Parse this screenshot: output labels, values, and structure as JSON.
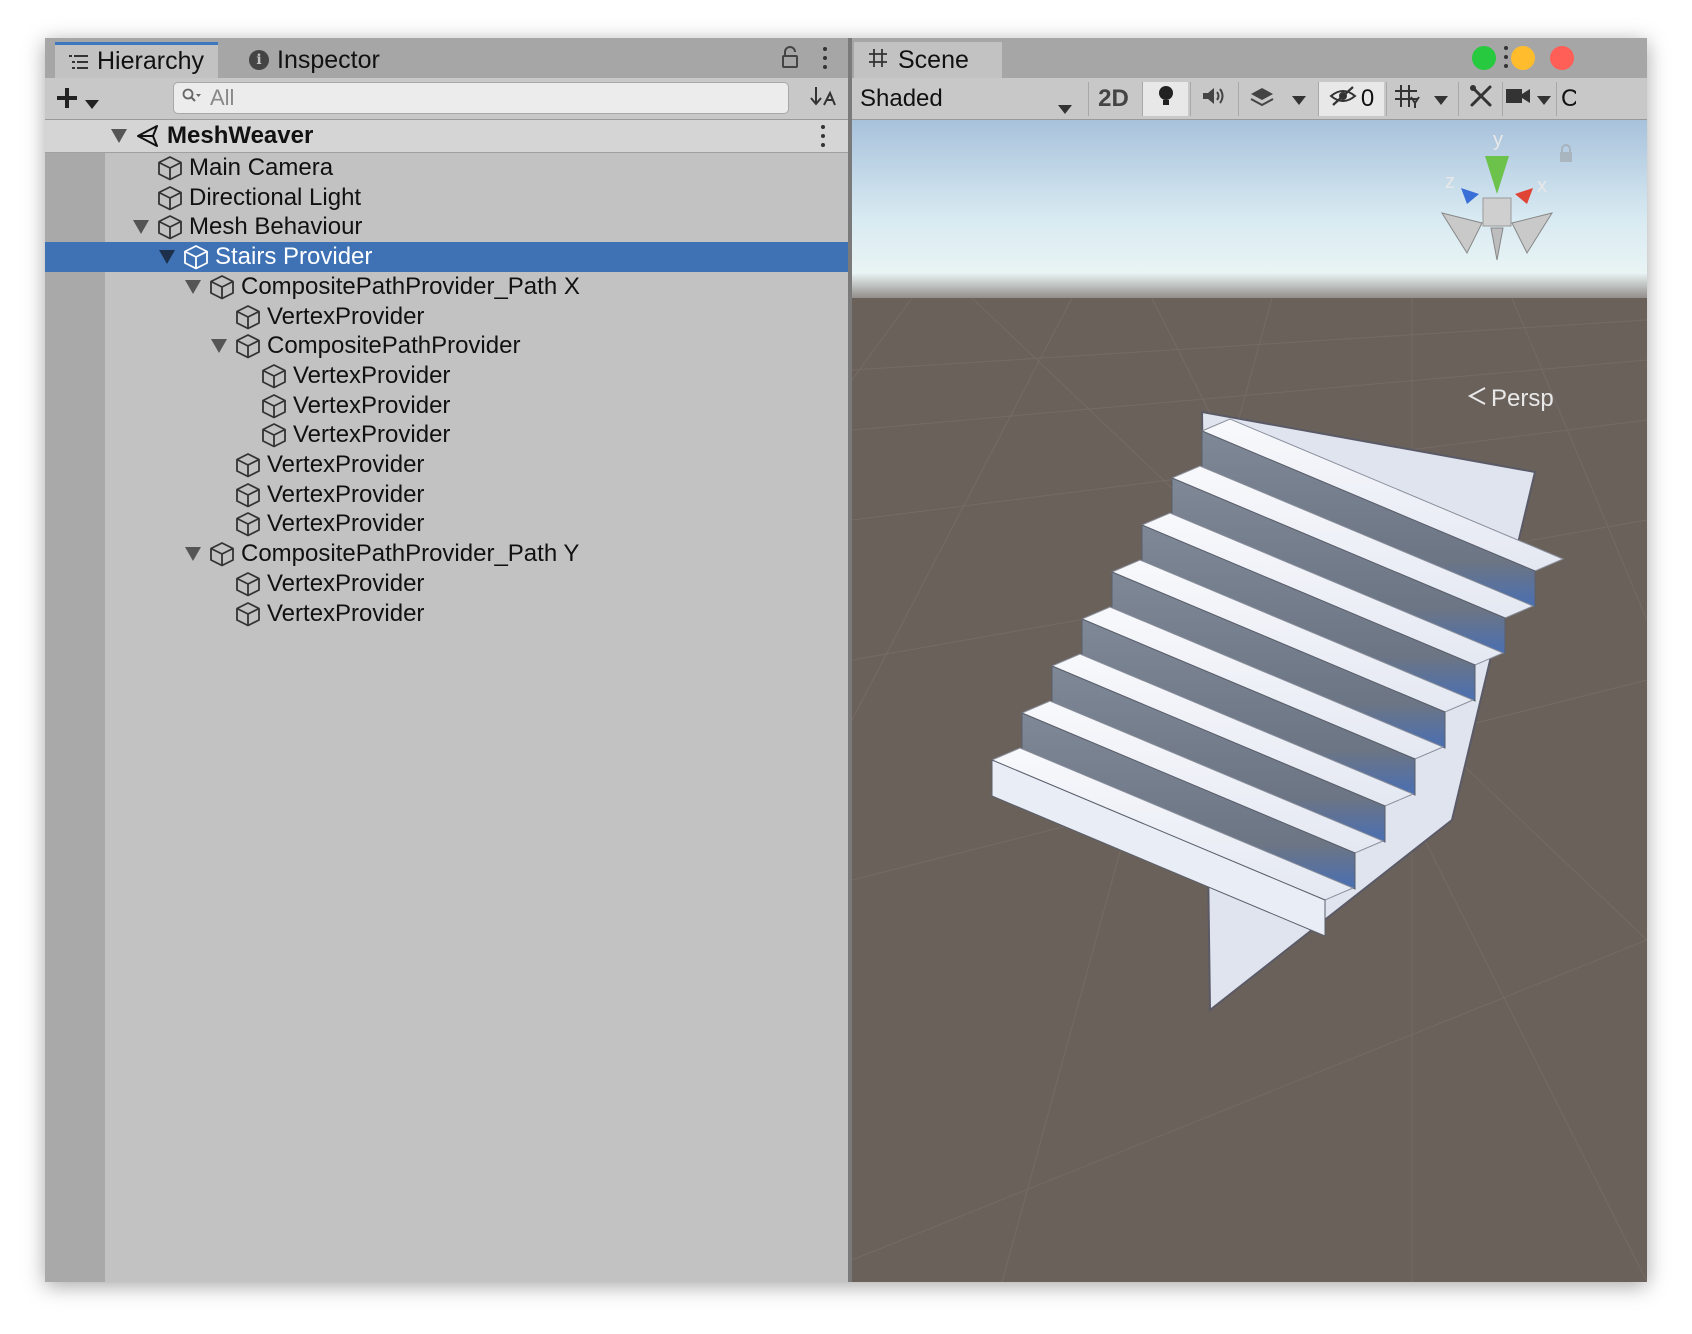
{
  "hierarchy_panel": {
    "tabs": [
      {
        "label": "Hierarchy",
        "icon": "list-icon",
        "active": true
      },
      {
        "label": "Inspector",
        "icon": "info-icon",
        "active": false
      }
    ],
    "search": {
      "placeholder": "All",
      "value": ""
    },
    "scene": {
      "name": "MeshWeaver"
    },
    "tree": [
      {
        "label": "Main Camera",
        "depth": 1,
        "expanded": null,
        "selected": false
      },
      {
        "label": "Directional Light",
        "depth": 1,
        "expanded": null,
        "selected": false
      },
      {
        "label": "Mesh Behaviour",
        "depth": 1,
        "expanded": true,
        "selected": false
      },
      {
        "label": "Stairs Provider",
        "depth": 2,
        "expanded": true,
        "selected": true
      },
      {
        "label": "CompositePathProvider_Path X",
        "depth": 3,
        "expanded": true,
        "selected": false
      },
      {
        "label": "VertexProvider",
        "depth": 4,
        "expanded": null,
        "selected": false
      },
      {
        "label": "CompositePathProvider",
        "depth": 4,
        "expanded": true,
        "selected": false
      },
      {
        "label": "VertexProvider",
        "depth": 5,
        "expanded": null,
        "selected": false
      },
      {
        "label": "VertexProvider",
        "depth": 5,
        "expanded": null,
        "selected": false
      },
      {
        "label": "VertexProvider",
        "depth": 5,
        "expanded": null,
        "selected": false
      },
      {
        "label": "VertexProvider",
        "depth": 4,
        "expanded": null,
        "selected": false
      },
      {
        "label": "VertexProvider",
        "depth": 4,
        "expanded": null,
        "selected": false
      },
      {
        "label": "VertexProvider",
        "depth": 4,
        "expanded": null,
        "selected": false
      },
      {
        "label": "CompositePathProvider_Path Y",
        "depth": 3,
        "expanded": true,
        "selected": false
      },
      {
        "label": "VertexProvider",
        "depth": 4,
        "expanded": null,
        "selected": false
      },
      {
        "label": "VertexProvider",
        "depth": 4,
        "expanded": null,
        "selected": false
      }
    ]
  },
  "scene_panel": {
    "tab": {
      "label": "Scene",
      "icon": "grid-icon"
    },
    "toolbar": {
      "shading_mode": "Shaded",
      "mode_2d": "2D",
      "hidden_count": "0",
      "cut_off": "C"
    },
    "gizmo": {
      "y": "y",
      "x": "x",
      "z": "z"
    },
    "projection": "Persp",
    "window_controls": {
      "green": "#27c93f",
      "yellow": "#ffbd2e",
      "red": "#ff5f56"
    }
  },
  "colors": {
    "selection": "#3e72b5",
    "panel_bg": "#c2c2c2",
    "ground": "#6b615b",
    "stair_top": "#f4f6fb",
    "stair_riser": "#6f7886"
  }
}
